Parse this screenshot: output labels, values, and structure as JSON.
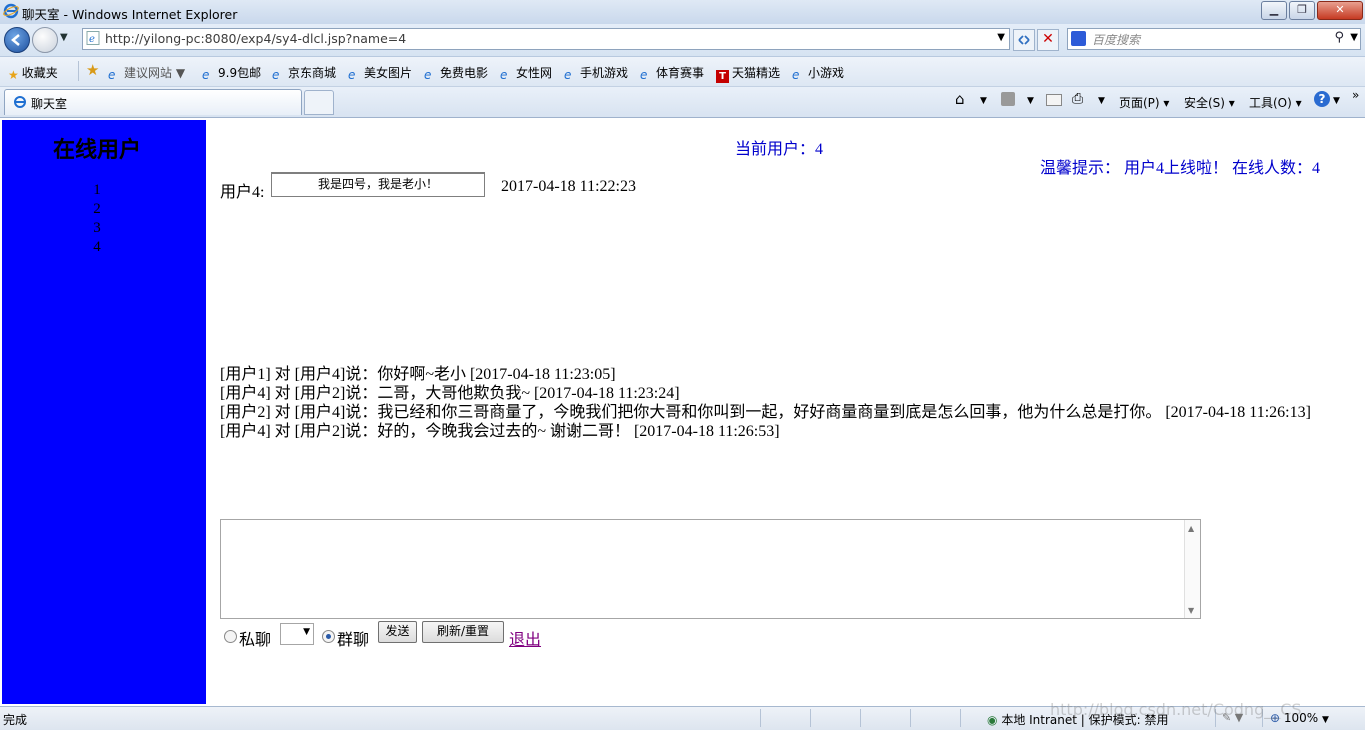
{
  "window": {
    "title": "聊天室 - Windows Internet Explorer"
  },
  "address_bar": {
    "url": "http://yilong-pc:8080/exp4/sy4-dlcl.jsp?name=4"
  },
  "search": {
    "placeholder": "百度搜索"
  },
  "favorites": {
    "label": "收藏夹",
    "items": [
      "建议网站",
      "9.9包邮",
      "京东商城",
      "美女图片",
      "免费电影",
      "女性网",
      "手机游戏",
      "体育赛事",
      "天猫精选",
      "小游戏"
    ]
  },
  "tab": {
    "label": "聊天室"
  },
  "commands": {
    "page": "页面(P)",
    "safety": "安全(S)",
    "tools": "工具(O)"
  },
  "sidebar": {
    "heading": "在线用户",
    "users": [
      "1",
      "2",
      "3",
      "4"
    ]
  },
  "header": {
    "current_user": "当前用户：4",
    "notice": "温馨提示：  用户4上线啦！   在线人数：4"
  },
  "message": {
    "label": "用户4:",
    "text": "我是四号，我是老小！",
    "time": "2017-04-18 11:22:23"
  },
  "chat_log": [
    "[用户1] 对  [用户4]说：你好啊~老小  [2017-04-18 11:23:05]",
    "[用户4] 对  [用户2]说：二哥，大哥他欺负我~  [2017-04-18 11:23:24]",
    "[用户2] 对  [用户4]说：我已经和你三哥商量了，今晚我们把你大哥和你叫到一起，好好商量商量到底是怎么回事，他为什么总是打你。  [2017-04-18 11:26:13]",
    "[用户4] 对  [用户2]说：好的，今晚我会过去的~ 谢谢二哥！   [2017-04-18 11:26:53]"
  ],
  "controls": {
    "private_label": "私聊",
    "group_label": "群聊",
    "send": "发送",
    "refresh": "刷新/重置",
    "logout": "退出"
  },
  "status": {
    "text": "完成",
    "zone": "本地 Intranet | 保护模式: 禁用",
    "zoom": "100%"
  },
  "watermark": "http://blog.csdn.net/Codng__CS",
  "colors": {
    "sidebar": "#0000ff",
    "highlight_text": "#0000cc",
    "link_visited": "#800080"
  }
}
